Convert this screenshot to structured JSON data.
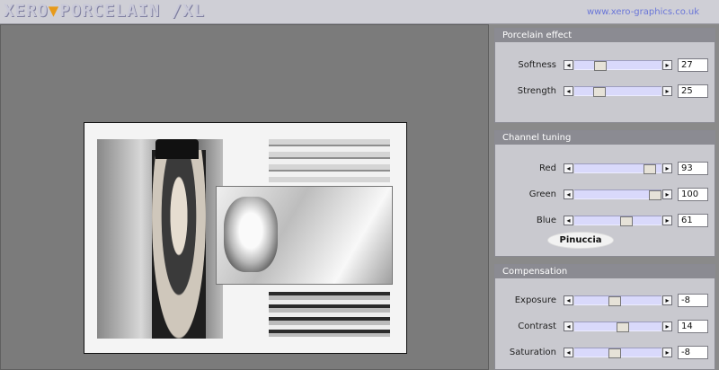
{
  "header": {
    "logo_text": "XERO",
    "logo_mark": "▼",
    "logo_rest": "PORCELAIN /XL",
    "url": "www.xero-graphics.co.uk"
  },
  "panels": [
    {
      "title": "Porcelain effect",
      "controls": [
        {
          "label": "Softness",
          "value": "27",
          "level": 0.27
        },
        {
          "label": "Strength",
          "value": "25",
          "level": 0.25
        }
      ]
    },
    {
      "title": "Channel tuning",
      "controls": [
        {
          "label": "Red",
          "value": "93",
          "level": 0.93
        },
        {
          "label": "Green",
          "value": "100",
          "level": 1.0
        },
        {
          "label": "Blue",
          "value": "61",
          "level": 0.61
        }
      ],
      "watermark": "Pinuccia"
    },
    {
      "title": "Compensation",
      "controls": [
        {
          "label": "Exposure",
          "value": "-8",
          "level": 0.46
        },
        {
          "label": "Contrast",
          "value": "14",
          "level": 0.57
        },
        {
          "label": "Saturation",
          "value": "-8",
          "level": 0.46
        }
      ]
    }
  ],
  "icons": {
    "decrement": "◂",
    "increment": "▸"
  },
  "colors": {
    "title_bar": "#cfcfd6",
    "panel_header": "#8b8b92",
    "panel_body": "#c9c9cf",
    "slider_track": "#d9d9fb",
    "logo_mark": "#e79a1a",
    "url_text": "#6a76d8"
  }
}
